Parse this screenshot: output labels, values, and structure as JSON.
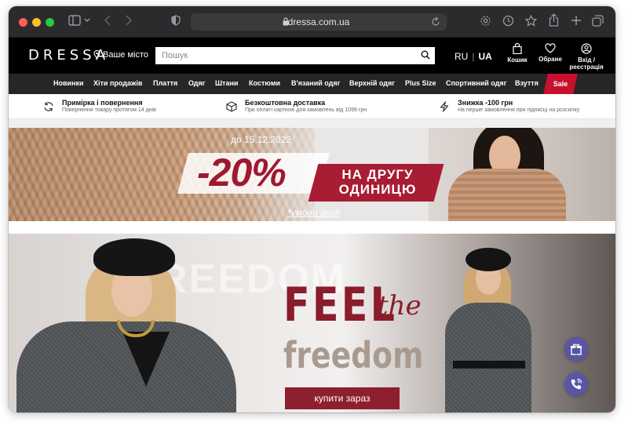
{
  "browser": {
    "url": "dressa.com.ua"
  },
  "header": {
    "logo": "DRESSA",
    "location": "Ваше місто",
    "search_placeholder": "Пошук",
    "lang_ru": "RU",
    "lang_sep": "|",
    "lang_ua": "UA",
    "cart": "Кошик",
    "favorites": "Обране",
    "login_line1": "Вхід /",
    "login_line2": "реєстрація"
  },
  "nav": {
    "items": [
      "Новинки",
      "Хіти продажів",
      "Плаття",
      "Одяг",
      "Штани",
      "Костюми",
      "В'язаний одяг",
      "Верхній одяг",
      "Plus Size",
      "Спортивний одяг",
      "Взуття"
    ],
    "sale": "Sale"
  },
  "benefits": [
    {
      "title": "Примірка і повернення",
      "subtitle": "Повернення товару протягом 14 днів",
      "icon": "refresh-icon"
    },
    {
      "title": "Безкоштовна доставка",
      "subtitle": "При оплаті карткою для замовлень від 1099 грн",
      "icon": "box-icon"
    },
    {
      "title": "Знижка -100 грн",
      "subtitle": "На перше замовлення при підписці на розсилку",
      "icon": "lightning-icon"
    }
  ],
  "promo": {
    "date": "до 15.12.2022",
    "percent": "-20%",
    "ribbon_line1": "НА ДРУГУ",
    "ribbon_line2": "ОДИНИЦЮ",
    "terms": "*умови акції"
  },
  "hero": {
    "background_word": "REEDOM",
    "feel": "FEEL",
    "the": "the",
    "freedom": "freedom",
    "cta": "купити зараз"
  },
  "colors": {
    "accent": "#a81c34",
    "fab": "#5a55a6"
  }
}
